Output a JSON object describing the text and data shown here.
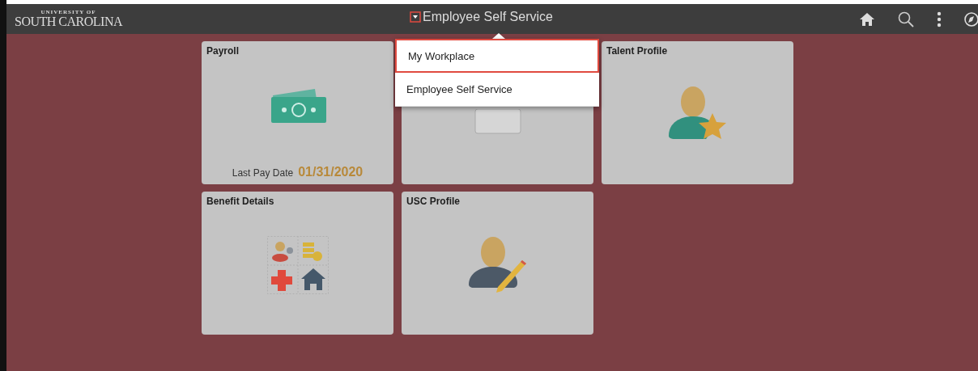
{
  "header": {
    "logo_small": "UNIVERSITY OF",
    "logo_large": "SOUTH CAROLINA",
    "title": "Employee Self Service"
  },
  "menu": [
    {
      "label": "My Workplace",
      "selected": true
    },
    {
      "label": "Employee Self Service",
      "selected": false
    }
  ],
  "tiles": [
    {
      "kind": "money",
      "title": "Payroll",
      "caption": "Last Pay Date",
      "value": "01/31/2020"
    },
    {
      "kind": "obscured"
    },
    {
      "kind": "person-star",
      "title": "Talent Profile"
    },
    {
      "kind": "benefits",
      "title": "Benefit Details"
    },
    {
      "kind": "person-pencil",
      "title": "USC Profile"
    }
  ]
}
